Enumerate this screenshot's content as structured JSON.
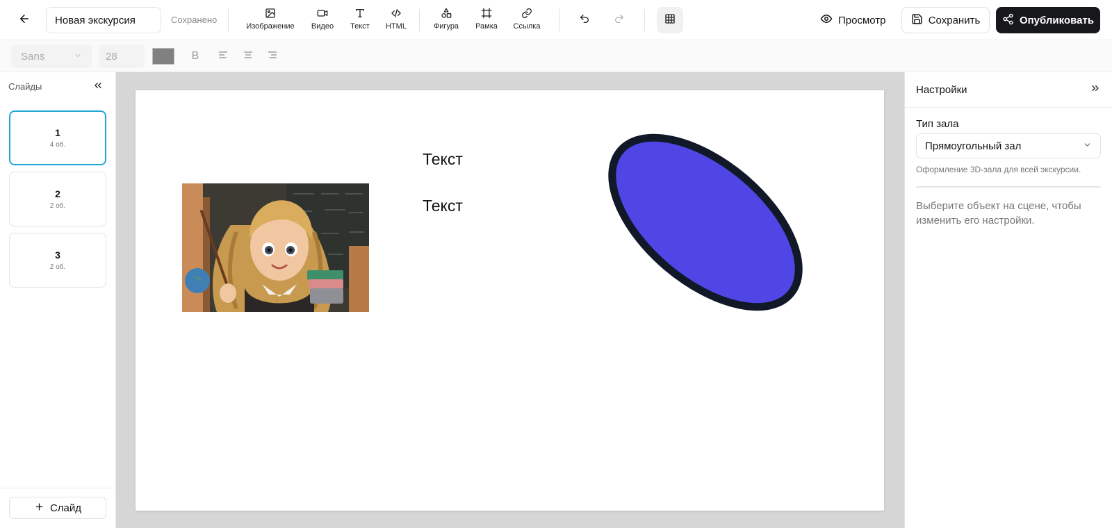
{
  "header": {
    "back_icon": "arrow-left-icon",
    "title_value": "Новая экскурсия",
    "save_status": "Сохранено",
    "tools": [
      {
        "label": "Изображение",
        "icon": "image-icon"
      },
      {
        "label": "Видео",
        "icon": "video-icon"
      },
      {
        "label": "Текст",
        "icon": "text-icon"
      },
      {
        "label": "HTML",
        "icon": "code-icon"
      },
      {
        "label": "Фигура",
        "icon": "shapes-icon"
      },
      {
        "label": "Рамка",
        "icon": "frame-icon"
      },
      {
        "label": "Ссылка",
        "icon": "link-icon"
      }
    ],
    "undo_icon": "undo-icon",
    "redo_icon": "redo-icon",
    "grid_icon": "grid-icon",
    "preview_label": "Просмотр",
    "save_label": "Сохранить",
    "publish_label": "Опубликовать"
  },
  "format": {
    "font_family": "Sans",
    "font_size": "28",
    "text_color": "#808080",
    "bold_label": "B",
    "align": [
      "align-left-icon",
      "align-center-icon",
      "align-right-icon"
    ]
  },
  "slides": {
    "title": "Слайды",
    "items": [
      {
        "number": "1",
        "count": "4 об.",
        "active": true
      },
      {
        "number": "2",
        "count": "2 об.",
        "active": false
      },
      {
        "number": "3",
        "count": "2 об.",
        "active": false
      }
    ],
    "add_label": "Слайд"
  },
  "canvas": {
    "texts": [
      "Текст",
      "Текст"
    ],
    "shape": {
      "fill": "#4f46e5",
      "stroke": "#111827"
    },
    "image_icon": "teacher-illustration"
  },
  "settings": {
    "title": "Настройки",
    "hall_label": "Тип зала",
    "hall_value": "Прямоугольный зал",
    "hall_hint": "Оформление 3D-зала для всей экскурсии.",
    "empty_text": "Выберите объект на сцене, чтобы изменить его настройки."
  }
}
